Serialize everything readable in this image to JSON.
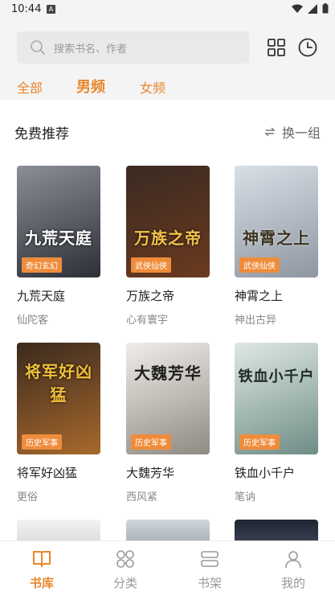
{
  "status": {
    "time": "10:44",
    "notif_letter": "A"
  },
  "search": {
    "placeholder": "搜索书名、作者"
  },
  "tabs": [
    {
      "label": "全部",
      "active": false
    },
    {
      "label": "男频",
      "active": true
    },
    {
      "label": "女频",
      "active": false
    }
  ],
  "section": {
    "title": "免费推荐",
    "refresh_label": "换一组"
  },
  "books": [
    {
      "title": "九荒天庭",
      "author": "仙陀客",
      "tag": "奇幻玄幻",
      "cover_text": "九荒天庭",
      "cover_colors": [
        "#8a8f97",
        "#2c2f36"
      ]
    },
    {
      "title": "万族之帝",
      "author": "心有寰宇",
      "tag": "武侠仙侠",
      "cover_text": "万族之帝",
      "cover_colors": [
        "#3a2a22",
        "#6b3a1f"
      ]
    },
    {
      "title": "神霄之上",
      "author": "神出古异",
      "tag": "武侠仙侠",
      "cover_text": "神霄之上",
      "cover_colors": [
        "#d9dfe6",
        "#8e96a3"
      ]
    },
    {
      "title": "将军好凶猛",
      "author": "更俗",
      "tag": "历史军事",
      "cover_text": "将军好凶猛",
      "cover_colors": [
        "#3b2a1e",
        "#a8692c"
      ]
    },
    {
      "title": "大魏芳华",
      "author": "西风紧",
      "tag": "历史军事",
      "cover_text": "大魏芳华",
      "cover_colors": [
        "#f0eeea",
        "#8f8a82"
      ]
    },
    {
      "title": "铁血小千户",
      "author": "笔讷",
      "tag": "历史军事",
      "cover_text": "铁血小千户",
      "cover_colors": [
        "#dfe8e4",
        "#6f8d86"
      ]
    }
  ],
  "nav": [
    {
      "label": "书库",
      "icon": "book-open-icon",
      "active": true
    },
    {
      "label": "分类",
      "icon": "category-grid-icon",
      "active": false
    },
    {
      "label": "书架",
      "icon": "shelf-icon",
      "active": false
    },
    {
      "label": "我的",
      "icon": "user-icon",
      "active": false
    }
  ],
  "colors": {
    "accent": "#e8872e",
    "tag_bg": "#ef8c3b",
    "topbar_bg": "#f4f4f4"
  }
}
